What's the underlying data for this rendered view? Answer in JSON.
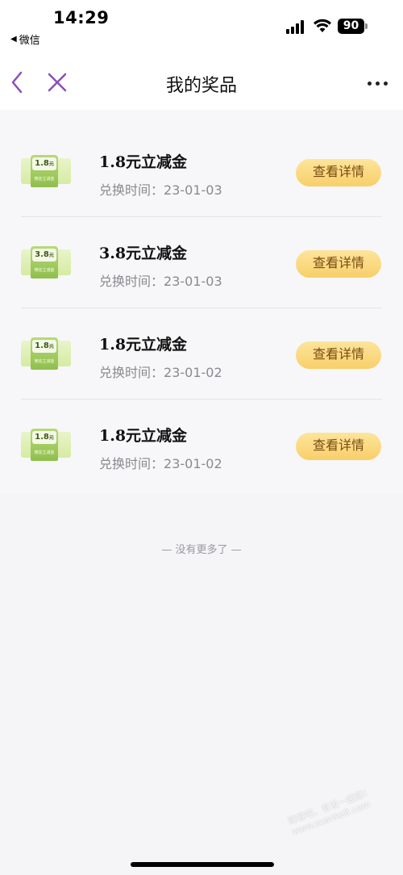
{
  "status_bar": {
    "time": "14:29",
    "back_app": "微信",
    "battery": "90"
  },
  "nav": {
    "title": "我的奖品"
  },
  "prizes": [
    {
      "thumb_value": "1.8",
      "thumb_unit": "元",
      "thumb_sub": "微信立减金",
      "title": "1.8元立减金",
      "date_label": "兑换时间：",
      "date": "23-01-03",
      "button": "查看详情"
    },
    {
      "thumb_value": "3.8",
      "thumb_unit": "元",
      "thumb_sub": "微信立减金",
      "title": "3.8元立减金",
      "date_label": "兑换时间：",
      "date": "23-01-03",
      "button": "查看详情"
    },
    {
      "thumb_value": "1.8",
      "thumb_unit": "元",
      "thumb_sub": "微信立减金",
      "title": "1.8元立减金",
      "date_label": "兑换时间：",
      "date": "23-01-02",
      "button": "查看详情"
    },
    {
      "thumb_value": "1.8",
      "thumb_unit": "元",
      "thumb_sub": "微信立减金",
      "title": "1.8元立减金",
      "date_label": "兑换时间：",
      "date": "23-01-02",
      "button": "查看详情"
    }
  ],
  "footer": {
    "no_more": "— 没有更多了 —"
  },
  "watermark": "赚客吧，有没一起赚！www.zuanke8.com",
  "colors": {
    "accent_purple": "#8a4fb8",
    "button_gold": "#f8cf6a",
    "button_text": "#7a4a12"
  },
  "icons": {
    "back": "chevron-left-icon",
    "close": "close-icon",
    "more": "more-icon"
  }
}
